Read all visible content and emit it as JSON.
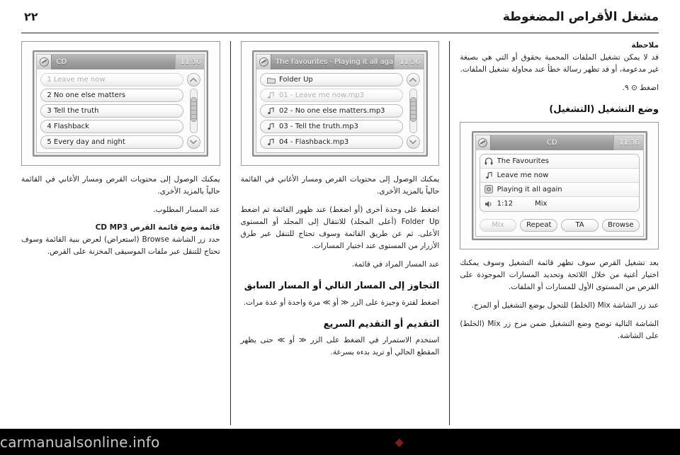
{
  "header": {
    "title": "مشغل الأقراص المضغوطة",
    "page_number": "٢٢"
  },
  "left_column": {
    "note_label": "ملاحظة",
    "note_text": "قد لا يمكن تشغيل الملفات المحمية بحقوق أو التي هي بصيغة غير مدعومة، أو قد تظهر رسالة خطأ عند محاولة تشغيل الملفات.",
    "note_ref": "اضغط ⊙ ٩.",
    "section_playback": "وضع التشغيل (التشغيل)",
    "figure_caption": "بعد تشغيل القرص سوف تظهر قائمة التشغيل وسوف يمكنك اختيار أغنية من خلال اللائحة وتحديد المسارات الموجودة على القرص من المستوى الأول للمسارات أو الملفات.",
    "mix_para_1": "عند زر الشاشة Mix (الخلط) للتحول بوضع التشغيل أو المزج.",
    "mix_para_2": "الشاشة التالية توضح وضع التشغيل ضمن مزج زر Mix (الخلط) على الشاشة."
  },
  "middle_column": {
    "para_1": "يمكنك الوصول إلى محتويات القرص ومسار الأغاني في القائمة حالياً بالمزيد الأخرى.",
    "para_2": "اضغط على وحدة أخرى (أو اضغط) عند ظهور القائمة ثم اضغط Folder Up (أعلى المجلد) للانتقال إلى المجلد أو المستوى الأعلى. ثم عن طريق القائمة وسوف تحتاج للتنقل عبر طرق الأزرار من المستوى عند اختيار المسارات.",
    "para_3": "عند المسار المراد في قائمة.",
    "section_skip": "التجاوز إلى المسار التالي أو المسار السابق",
    "skip_text": "اضغط لفترة وجيزة على الزر ≪ أو ≫ مرة واحدة أو عدة مرات.",
    "section_fwd_rev": "التقديم أو التقديم السريع",
    "fwd_rev_text": "استخدم الاستمرار في الضغط على الزر ≪ أو ≫ حتى يظهر المقطع الحالي أو تريد بدءه بسرعة."
  },
  "right_column": {
    "para_1": "يمكنك الوصول إلى محتويات القرص ومسار الأغاني في القائمة حالياً بالمزيد الأخرى.",
    "para_2": "عند المسار المطلوب.",
    "section_mp3": "قائمة وضع قائمة القرص CD MP3",
    "mp3_text": "حدد زر الشاشة Browse (استعراض) لعرض بنية القائمة وسوف تحتاج للتنقل عبر ملفات الموسيقى المخزنة على القرص."
  },
  "screens": {
    "screen1": {
      "badge_icon": "knob-icon",
      "title": "CD",
      "clock": "11:36",
      "rows": [
        {
          "icon": "headphones-icon",
          "text": "The Favourites"
        },
        {
          "icon": "note-icon",
          "text": "Leave me now"
        },
        {
          "icon": "disc-icon",
          "text": "Playing it all again"
        },
        {
          "icon": "speaker-icon",
          "text": "1:12",
          "extra": "Mix"
        }
      ],
      "buttons": [
        {
          "label": "Mix",
          "disabled": true
        },
        {
          "label": "Repeat",
          "disabled": false
        },
        {
          "label": "TA",
          "disabled": false
        },
        {
          "label": "Browse",
          "disabled": false
        }
      ]
    },
    "screen2": {
      "badge_icon": "knob-icon",
      "title": "The Favourites - Playing it all again",
      "clock": "11:36",
      "rows": [
        {
          "icon": "folder-icon",
          "text": "Folder Up",
          "dim": false
        },
        {
          "icon": "note-icon",
          "text": "01 - Leave me now.mp3",
          "dim": true
        },
        {
          "icon": "note-icon",
          "text": "02 - No one else matters.mp3",
          "dim": false
        },
        {
          "icon": "note-icon",
          "text": "03 - Tell the truth.mp3",
          "dim": false
        },
        {
          "icon": "note-icon",
          "text": "04 - Flashback.mp3",
          "dim": false
        }
      ],
      "scroll": {
        "up_icon": "chevron-up-icon",
        "down_icon": "chevron-down-icon"
      }
    },
    "screen3": {
      "badge_icon": "knob-icon",
      "title": "CD",
      "clock": "11:36",
      "rows": [
        {
          "text": "1 Leave me now",
          "dim": true
        },
        {
          "text": "2 No one else matters",
          "dim": false
        },
        {
          "text": "3 Tell the truth",
          "dim": false
        },
        {
          "text": "4 Flashback",
          "dim": false
        },
        {
          "text": "5 Every day and night",
          "dim": false
        }
      ],
      "scroll": {
        "up_icon": "chevron-up-icon",
        "down_icon": "chevron-down-icon"
      }
    }
  },
  "footer": {
    "watermark": "carmanualsonline.info",
    "logo_mark": "◆"
  }
}
